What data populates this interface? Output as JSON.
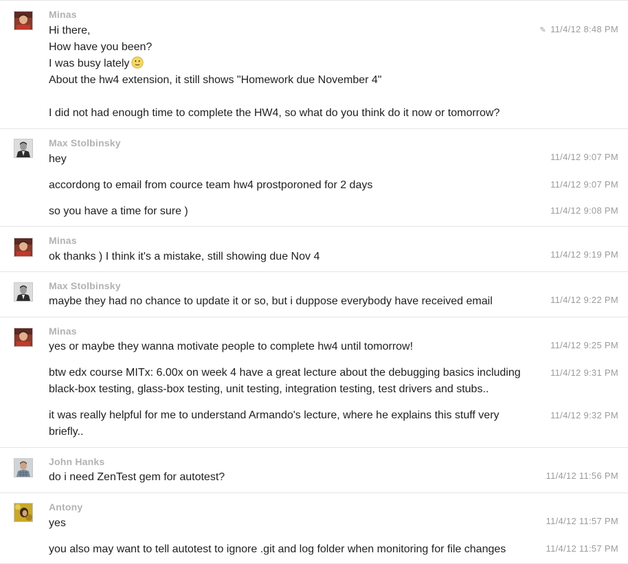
{
  "groups": [
    {
      "sender": "Minas",
      "avatar": "avatar-minas",
      "messages": [
        {
          "lines": [
            "Hi there,",
            "How have you been?",
            "I was busy lately",
            "About the hw4 extension, it still shows  \"Homework due November 4\"",
            "",
            "I did not had enough time to complete the HW4, so what do you think do it now or tomorrow?"
          ],
          "emoji": "slightly-smiling-face-emoji",
          "time": "11/4/12 8:48 PM",
          "edited_icon": "pencil-icon"
        }
      ]
    },
    {
      "sender": "Max Stolbinsky",
      "avatar": "avatar-max",
      "messages": [
        {
          "text": "hey",
          "time": "11/4/12 9:07 PM"
        },
        {
          "text": "accordong to email from cource team hw4 prostporoned for 2 days",
          "time": "11/4/12 9:07 PM"
        },
        {
          "text": "so you have a time for sure )",
          "time": "11/4/12 9:08 PM"
        }
      ]
    },
    {
      "sender": "Minas",
      "avatar": "avatar-minas",
      "messages": [
        {
          "text": "ok thanks )  I think it's a mistake, still showing due Nov 4",
          "time": "11/4/12 9:19 PM"
        }
      ]
    },
    {
      "sender": "Max Stolbinsky",
      "avatar": "avatar-max",
      "messages": [
        {
          "text": "maybe they had no chance to update it or so, but i duppose everybody have received email",
          "time": "11/4/12 9:22 PM"
        }
      ]
    },
    {
      "sender": "Minas",
      "avatar": "avatar-minas",
      "messages": [
        {
          "text": "yes or maybe they wanna motivate people to complete hw4 until tomorrow!",
          "time": "11/4/12 9:25 PM"
        },
        {
          "text": "btw edx course MITx: 6.00x on week 4 have a great lecture about the debugging basics including black-box testing, glass-box testing, unit testing, integration testing, test drivers and stubs..",
          "time": "11/4/12 9:31 PM"
        },
        {
          "text": "it was really helpful for me to understand Armando's lecture, where he explains this stuff very briefly..",
          "time": "11/4/12 9:32 PM"
        }
      ]
    },
    {
      "sender": "John Hanks",
      "avatar": "avatar-john",
      "messages": [
        {
          "text": "do i need ZenTest gem for autotest?",
          "time": "11/4/12 11:56 PM"
        }
      ]
    },
    {
      "sender": "Antony",
      "avatar": "avatar-antony",
      "messages": [
        {
          "text": "yes",
          "time": "11/4/12 11:57 PM"
        },
        {
          "text": "you also may want to tell autotest to ignore .git and log folder when monitoring for file changes",
          "time": "11/4/12 11:57 PM"
        }
      ]
    }
  ]
}
